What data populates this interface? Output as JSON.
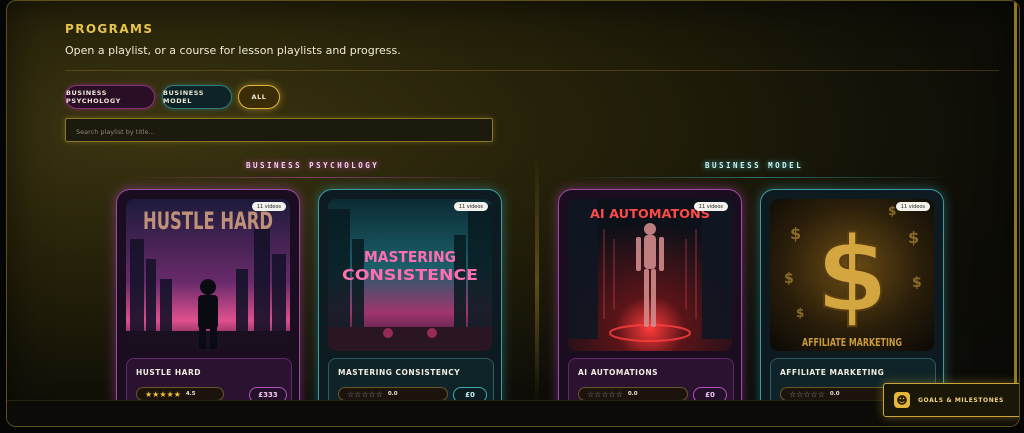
{
  "header": {
    "title": "PROGRAMS",
    "subtitle": "Open a playlist, or a course for lesson playlists and progress."
  },
  "filters": {
    "items": [
      {
        "label": "BUSINESS PSYCHOLOGY"
      },
      {
        "label": "BUSINESS MODEL"
      },
      {
        "label": "ALL",
        "selected": true
      }
    ]
  },
  "search": {
    "placeholder": "Search playlist by title..."
  },
  "columns": [
    {
      "heading": "BUSINESS PSYCHOLOGY",
      "accent": "#d24ad0",
      "cards": [
        {
          "title": "HUSTLE HARD",
          "badge": "11 videos",
          "art_text": "HUSTLE HARD",
          "stars": "★★★★★",
          "rating": "4.5",
          "price": "£333"
        },
        {
          "title": "MASTERING CONSISTENCY",
          "badge": "11 videos",
          "art_text_1": "MASTERING",
          "art_text_2": "CONSISTENCE",
          "stars": "☆☆☆☆☆",
          "rating": "0.0",
          "price": "£0"
        }
      ]
    },
    {
      "heading": "BUSINESS MODEL",
      "accent": "#3fd3dd",
      "cards": [
        {
          "title": "AI AUTOMATIONS",
          "badge": "11 videos",
          "art_text": "AI AUTOMATONS",
          "stars": "☆☆☆☆☆",
          "rating": "0.0",
          "price": "£0"
        },
        {
          "title": "AFFILIATE MARKETING",
          "badge": "11 videos",
          "art_text": "AFFILIATE MARKETING",
          "art_symbol": "$",
          "stars": "☆☆☆☆☆",
          "rating": "0.0",
          "price": "£0"
        }
      ]
    }
  ],
  "goals_button": {
    "label": "GOALS & MILESTONES",
    "icon": "smiley-icon",
    "icon_glyph": "☻"
  }
}
